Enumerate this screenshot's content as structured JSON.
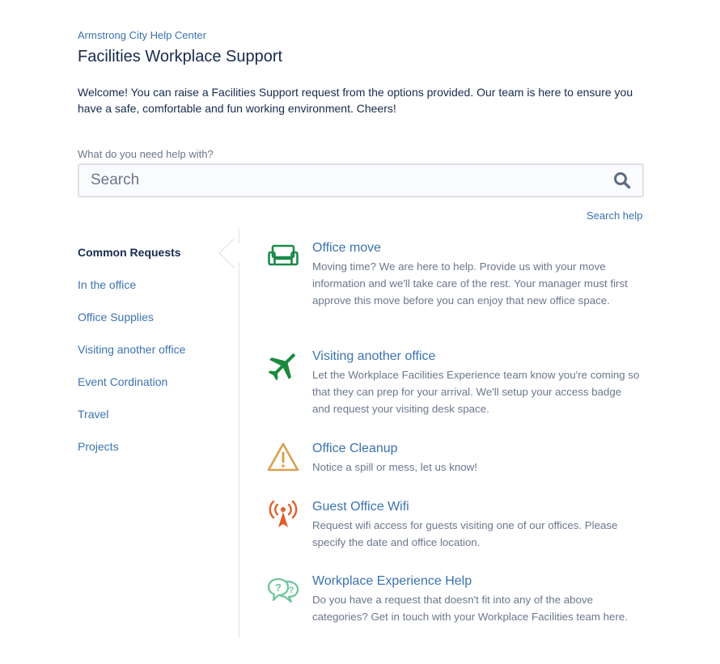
{
  "header": {
    "breadcrumb": "Armstrong City Help Center",
    "title": "Facilities Workplace Support",
    "welcome": "Welcome! You can raise a Facilities Support request from the options provided. Our team is here to ensure you have a safe, comfortable and fun working environment. Cheers!"
  },
  "search": {
    "label": "What do you need help with?",
    "placeholder": "Search",
    "value": "",
    "help_link": "Search help",
    "icon": "search-icon"
  },
  "sidebar": {
    "items": [
      {
        "label": "Common Requests",
        "active": true
      },
      {
        "label": "In the office"
      },
      {
        "label": "Office Supplies"
      },
      {
        "label": "Visiting another office"
      },
      {
        "label": "Event Cordination"
      },
      {
        "label": "Travel"
      },
      {
        "label": "Projects"
      }
    ]
  },
  "requests": [
    {
      "title": "Office move",
      "icon": "sofa-icon",
      "color": "#1d8a4a",
      "description": "Moving time? We are here to help. Provide us with your move information and we'll take care of the rest. Your manager must first approve this move before you can enjoy that new office space."
    },
    {
      "title": "Visiting another office",
      "icon": "airplane-icon",
      "color": "#1a8a3e",
      "description": "Let the Workplace Facilities Experience team know you're coming so that they can prep for your arrival. We'll setup your access badge and request your visiting desk space."
    },
    {
      "title": "Office Cleanup",
      "icon": "warning-icon",
      "color": "#d9a050",
      "description": "Notice a spill or mess, let us know!"
    },
    {
      "title": "Guest Office Wifi",
      "icon": "wifi-tower-icon",
      "color": "#e35d2a",
      "description": "Request wifi access for guests visiting one of our offices. Please specify the date and office location."
    },
    {
      "title": "Workplace Experience Help",
      "icon": "question-bubbles-icon",
      "color": "#6cc59a",
      "description": "Do you have a request that doesn't fit into any of the above categories? Get in touch with your Workplace Facilities team here."
    }
  ]
}
